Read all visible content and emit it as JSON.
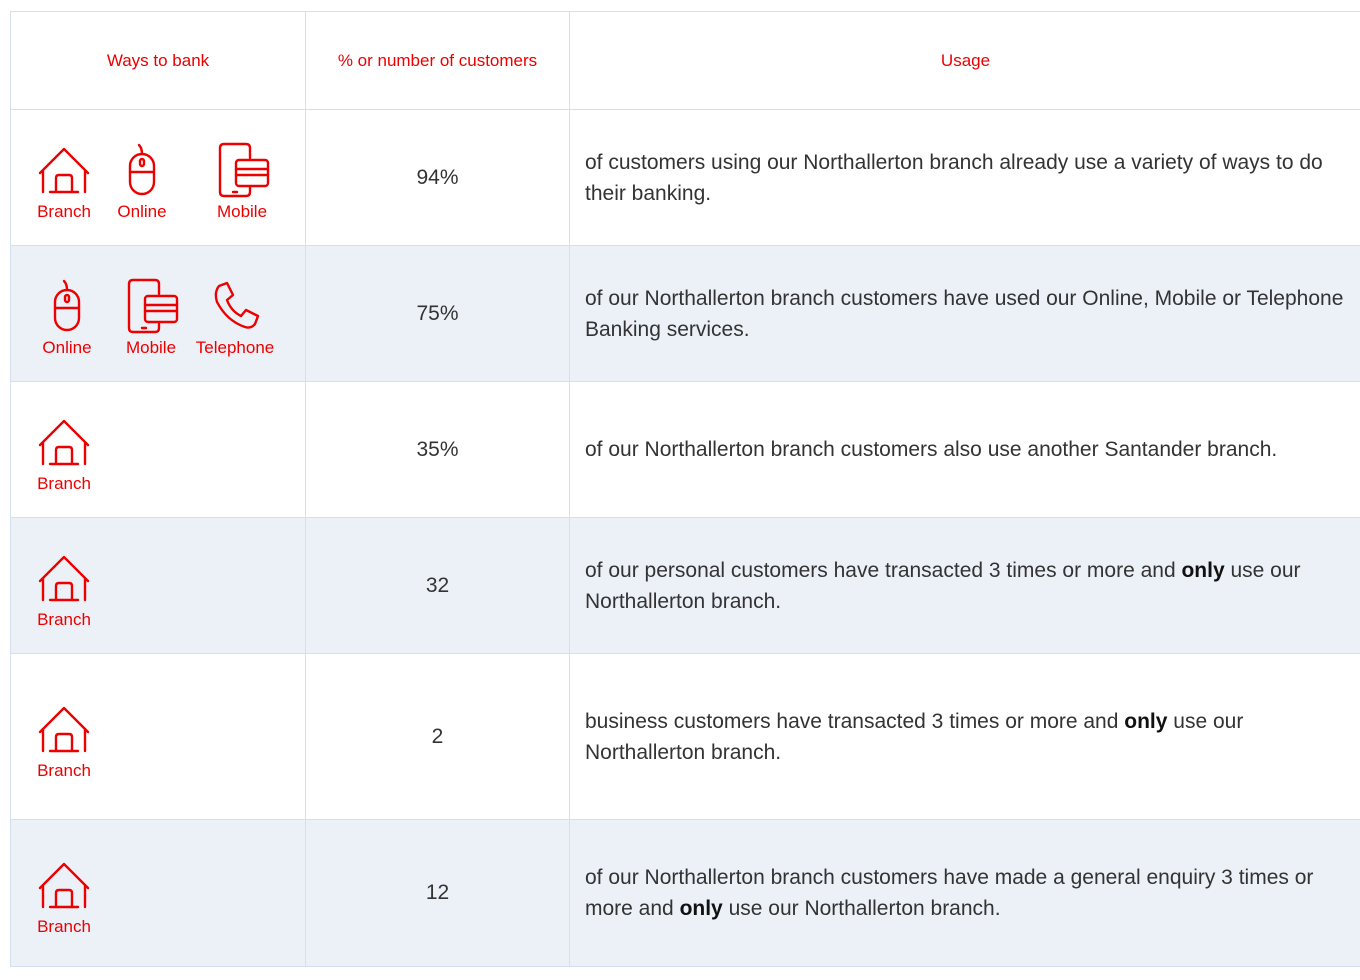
{
  "columns": [
    "Ways to bank",
    "% or number of customers",
    "Usage"
  ],
  "rows": [
    {
      "icons": [
        {
          "icon": "house-icon",
          "label": "Branch"
        },
        {
          "icon": "mouse-icon",
          "label": "Online"
        },
        {
          "icon": "mobile-card-icon",
          "label": "Mobile"
        }
      ],
      "value": "94%",
      "usage": [
        {
          "text": "of customers using our Northallerton branch already use a variety of ways to do their banking."
        }
      ]
    },
    {
      "icons": [
        {
          "icon": "mouse-icon",
          "label": "Online"
        },
        {
          "icon": "mobile-card-icon",
          "label": "Mobile"
        },
        {
          "icon": "phone-icon",
          "label": "Telephone"
        }
      ],
      "value": "75%",
      "usage": [
        {
          "text": "of our Northallerton branch customers have used our Online, Mobile or Telephone Banking services."
        }
      ]
    },
    {
      "icons": [
        {
          "icon": "house-icon",
          "label": "Branch"
        }
      ],
      "value": "35%",
      "usage": [
        {
          "text": "of our Northallerton branch customers also use another Santander branch."
        }
      ]
    },
    {
      "icons": [
        {
          "icon": "house-icon",
          "label": "Branch"
        }
      ],
      "value": "32",
      "usage": [
        {
          "text": "of our personal customers have transacted 3 times or more and "
        },
        {
          "text": "only",
          "bold": true
        },
        {
          "text": " use our Northallerton branch."
        }
      ]
    },
    {
      "icons": [
        {
          "icon": "house-icon",
          "label": "Branch"
        }
      ],
      "value": "2",
      "usage": [
        {
          "text": "business customers have transacted 3 times or more and "
        },
        {
          "text": "only",
          "bold": true
        },
        {
          "text": " use our Northallerton branch."
        }
      ]
    },
    {
      "icons": [
        {
          "icon": "house-icon",
          "label": "Branch"
        }
      ],
      "value": "12",
      "usage": [
        {
          "text": "of our Northallerton branch customers have made a general enquiry 3 times or more and "
        },
        {
          "text": "only",
          "bold": true
        },
        {
          "text": " use our Northallerton branch."
        }
      ]
    }
  ]
}
